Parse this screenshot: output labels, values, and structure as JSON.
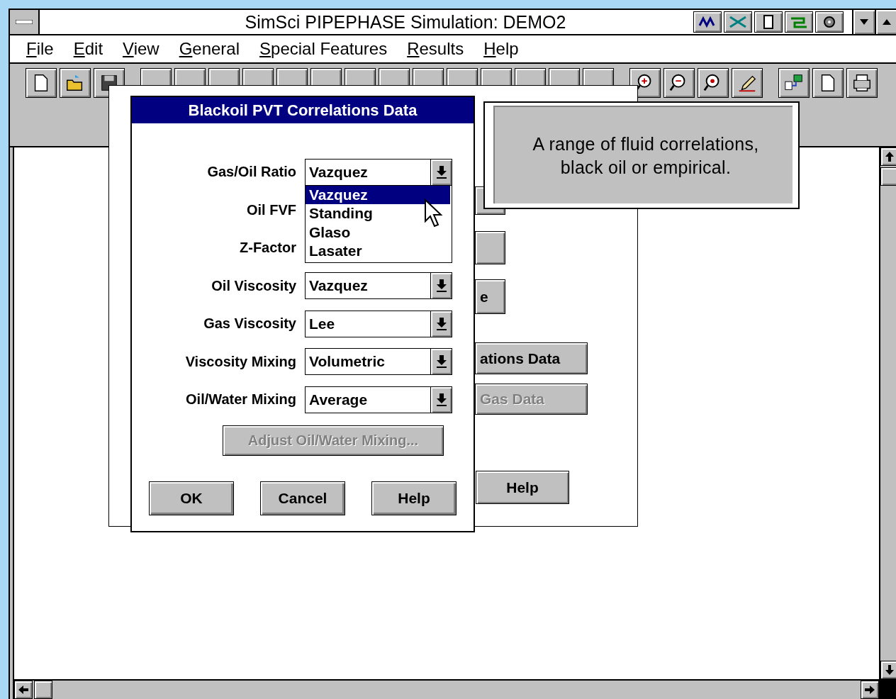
{
  "window": {
    "title": "SimSci PIPEPHASE Simulation: DEMO2"
  },
  "menu": [
    {
      "label": "File"
    },
    {
      "label": "Edit"
    },
    {
      "label": "View"
    },
    {
      "label": "General"
    },
    {
      "label": "Special Features"
    },
    {
      "label": "Results"
    },
    {
      "label": "Help"
    }
  ],
  "background_dialog": {
    "buttons": [
      {
        "kind": "blank"
      },
      {
        "kind": "blank"
      },
      {
        "kind": "labeled",
        "label": "e",
        "disabled": false
      },
      {
        "kind": "labeled",
        "label": "ations Data",
        "disabled": false
      },
      {
        "kind": "labeled",
        "label": "Gas Data",
        "disabled": true
      },
      {
        "kind": "labeled",
        "label": "Help",
        "disabled": false
      }
    ]
  },
  "dialog": {
    "title": "Blackoil PVT Correlations Data",
    "fields": [
      {
        "label": "Gas/Oil Ratio",
        "value": "Vazquez",
        "options": [
          {
            "label": "Vazquez",
            "selected": true
          },
          {
            "label": "Standing",
            "selected": false
          },
          {
            "label": "Glaso",
            "selected": false
          },
          {
            "label": "Lasater",
            "selected": false
          }
        ]
      },
      {
        "label": "Oil FVF"
      },
      {
        "label": "Z-Factor"
      },
      {
        "label": "Oil Viscosity",
        "value": "Vazquez"
      },
      {
        "label": "Gas Viscosity",
        "value": "Lee"
      },
      {
        "label": "Viscosity Mixing",
        "value": "Volumetric"
      },
      {
        "label": "Oil/Water Mixing",
        "value": "Average"
      }
    ],
    "adjust_button": {
      "label": "Adjust Oil/Water Mixing...",
      "disabled": true
    },
    "buttons": [
      {
        "label": "OK"
      },
      {
        "label": "Cancel"
      },
      {
        "label": "Help"
      }
    ]
  },
  "tooltip": {
    "text": "A range of fluid correlations,\nblack oil or empirical."
  }
}
